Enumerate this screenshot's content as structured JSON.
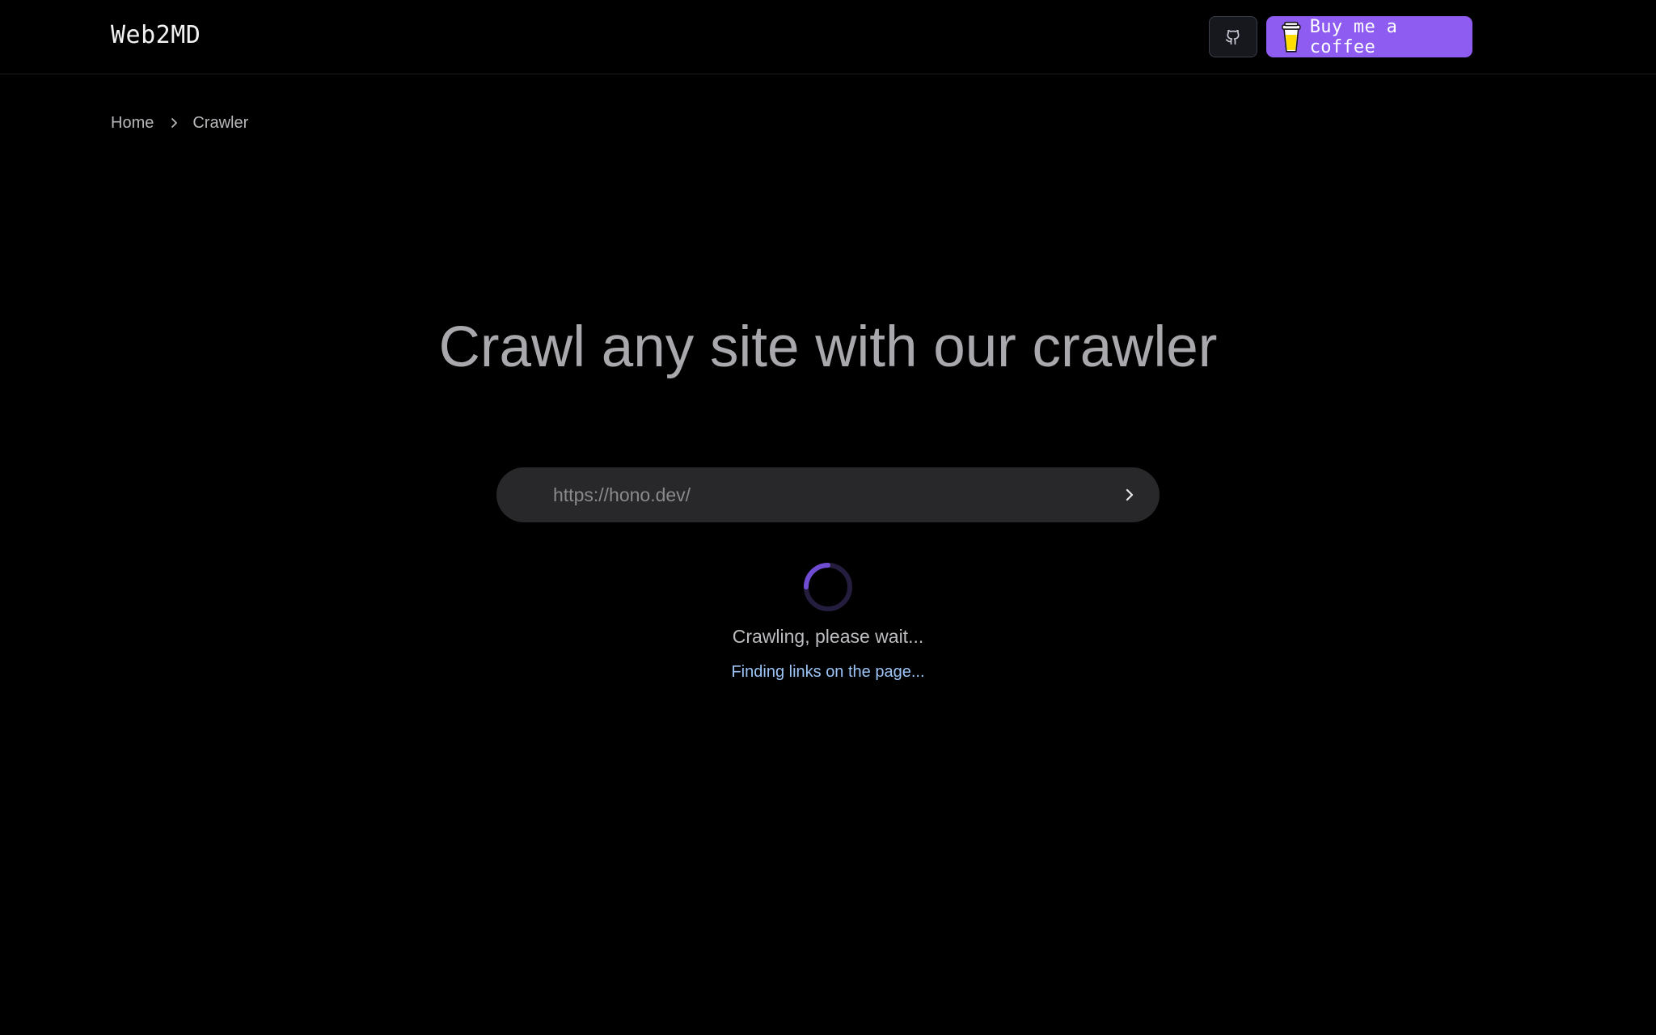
{
  "header": {
    "logo_text": "Web2MD",
    "github_icon": "github-icon",
    "coffee_icon": "coffee-cup-icon",
    "coffee_label": "Buy me a coffee",
    "accent_color": "#8f5cf2"
  },
  "breadcrumb": {
    "items": [
      "Home",
      "Crawler"
    ],
    "separator_icon": "chevron-right-icon"
  },
  "hero": {
    "title": "Crawl any site with our crawler"
  },
  "search": {
    "placeholder": "https://hono.dev/",
    "value": "",
    "submit_icon": "chevron-right-icon"
  },
  "status": {
    "spinner_icon": "loading-spinner-icon",
    "message": "Crawling, please wait...",
    "detail": "Finding links on the page...",
    "detail_color": "#9cc4f6"
  }
}
